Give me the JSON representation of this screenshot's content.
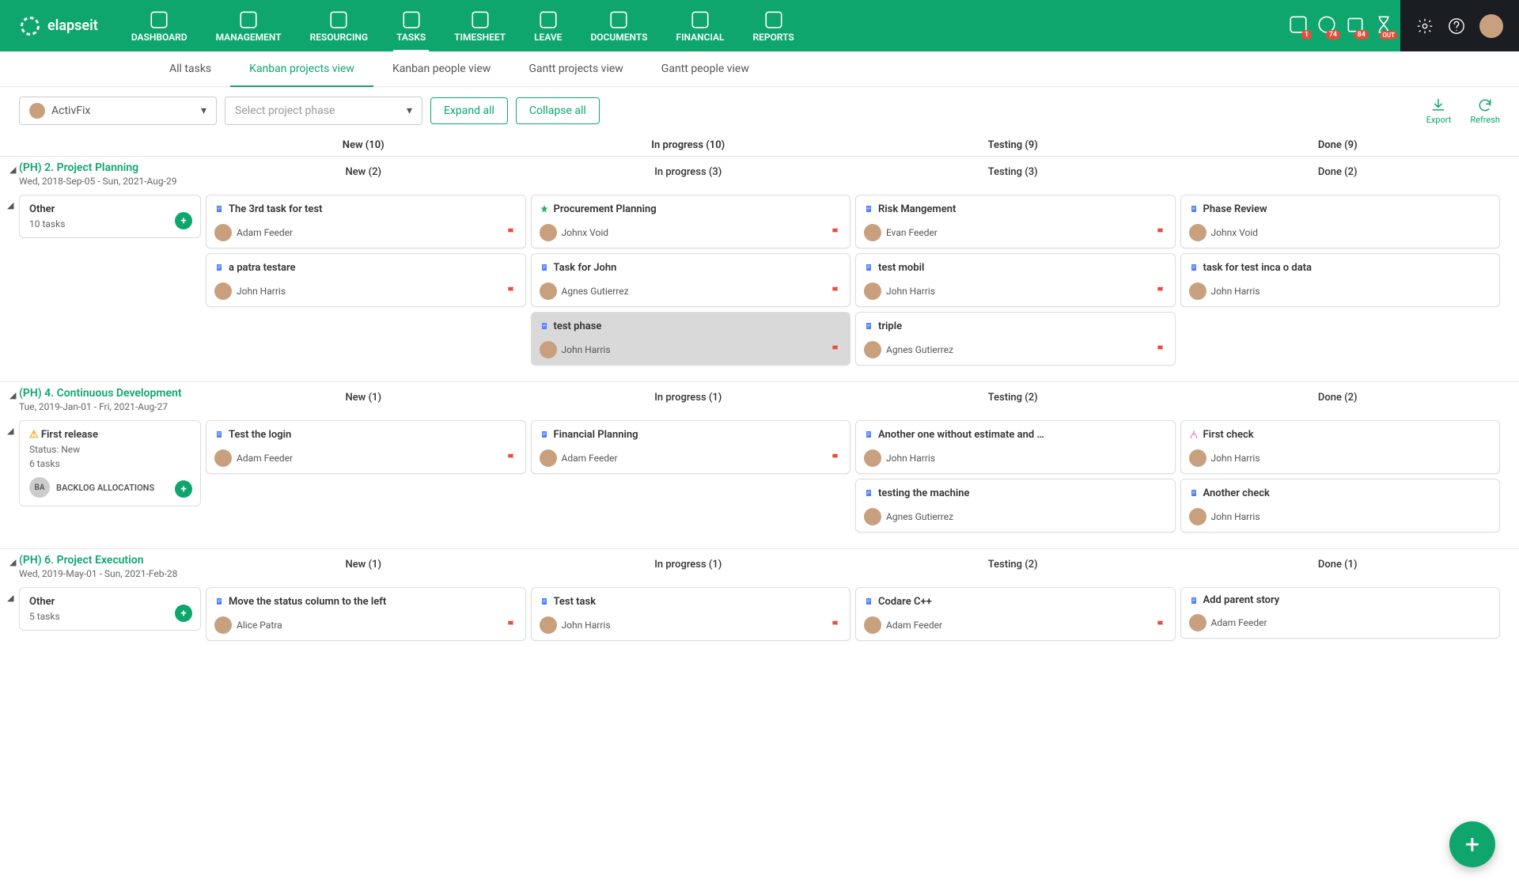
{
  "brand": "elapseit",
  "nav": [
    {
      "label": "DASHBOARD"
    },
    {
      "label": "MANAGEMENT"
    },
    {
      "label": "RESOURCING"
    },
    {
      "label": "TASKS",
      "active": true
    },
    {
      "label": "TIMESHEET"
    },
    {
      "label": "LEAVE"
    },
    {
      "label": "DOCUMENTS"
    },
    {
      "label": "FINANCIAL"
    },
    {
      "label": "REPORTS"
    }
  ],
  "subnav": [
    {
      "label": "All tasks"
    },
    {
      "label": "Kanban projects view",
      "active": true
    },
    {
      "label": "Kanban people view"
    },
    {
      "label": "Gantt projects view"
    },
    {
      "label": "Gantt people view"
    }
  ],
  "badges": {
    "a": "1",
    "b": "74",
    "c": "84",
    "d": "OUT"
  },
  "toolbar": {
    "project": "ActivFix",
    "phase_placeholder": "Select project phase",
    "expand": "Expand all",
    "collapse": "Collapse all",
    "export": "Export",
    "refresh": "Refresh"
  },
  "columns": [
    "New (10)",
    "In progress (10)",
    "Testing (9)",
    "Done (9)"
  ],
  "phases": [
    {
      "title": "(PH) 2. Project Planning",
      "dates": "Wed, 2018-Sep-05 - Sun, 2021-Aug-29",
      "counts": [
        "New (2)",
        "In progress (3)",
        "Testing (3)",
        "Done (2)"
      ],
      "side": {
        "title": "Other",
        "sub": "10 tasks"
      },
      "cols": [
        [
          {
            "t": "The 3rd task for test",
            "a": "Adam Feeder",
            "type": "blue",
            "pri": "down-red",
            "flag": true
          },
          {
            "t": "a patra testare",
            "a": "John Harris",
            "type": "blue",
            "pri": "down-red",
            "flag": true
          }
        ],
        [
          {
            "t": "Procurement Planning",
            "a": "Johnx Void",
            "type": "star",
            "pri": "up-red",
            "flag": true
          },
          {
            "t": "Task for John",
            "a": "Agnes Gutierrez",
            "type": "blue",
            "pri": "down-red",
            "flag": true
          },
          {
            "t": "test phase",
            "a": "John Harris",
            "type": "blue",
            "pri": "down-red",
            "flag": true,
            "dim": true
          }
        ],
        [
          {
            "t": "Risk Mangement",
            "a": "Evan Feeder",
            "type": "blue",
            "pri": "down-red",
            "flag": true
          },
          {
            "t": "test mobil",
            "a": "John Harris",
            "type": "blue",
            "pri": "down-red",
            "flag": true
          },
          {
            "t": "triple",
            "a": "Agnes Gutierrez",
            "type": "blue",
            "pri": "down-red",
            "flag": true
          }
        ],
        [
          {
            "t": "Phase Review",
            "a": "Johnx Void",
            "type": "blue",
            "pri": "down-red"
          },
          {
            "t": "task for test inca o data",
            "a": "John Harris",
            "type": "blue",
            "pri": "down-red"
          }
        ]
      ]
    },
    {
      "title": "(PH) 4. Continuous Development",
      "dates": "Tue, 2019-Jan-01 - Fri, 2021-Aug-27",
      "counts": [
        "New (1)",
        "In progress (1)",
        "Testing (2)",
        "Done (2)"
      ],
      "side": {
        "title": "First release",
        "status": "Status: New",
        "sub": "6 tasks",
        "ba": "BACKLOG ALLOCATIONS",
        "warn": true,
        "pri": "down-red"
      },
      "cols": [
        [
          {
            "t": "Test the login",
            "a": "Adam Feeder",
            "type": "blue",
            "pri": "down-red",
            "flag": true
          }
        ],
        [
          {
            "t": "Financial Planning",
            "a": "Adam Feeder",
            "type": "blue",
            "pri": "down-red",
            "flag": true
          }
        ],
        [
          {
            "t": "Another one without estimate and …",
            "a": "John Harris",
            "type": "blue",
            "pri": "down-red"
          },
          {
            "t": "testing the machine",
            "a": "Agnes Gutierrez",
            "type": "blue",
            "pri": "down-red"
          }
        ],
        [
          {
            "t": "First check",
            "a": "John Harris",
            "type": "pink",
            "pri": "up-red"
          },
          {
            "t": "Another check",
            "a": "John Harris",
            "type": "blue",
            "pri": "down-green"
          }
        ]
      ]
    },
    {
      "title": "(PH) 6. Project Execution",
      "dates": "Wed, 2019-May-01 - Sun, 2021-Feb-28",
      "counts": [
        "New (1)",
        "In progress (1)",
        "Testing (2)",
        "Done (1)"
      ],
      "side": {
        "title": "Other",
        "sub": "5 tasks"
      },
      "cols": [
        [
          {
            "t": "Move the status column to the left",
            "a": "Alice Patra",
            "type": "blue",
            "pri": "down-red",
            "flag": true
          }
        ],
        [
          {
            "t": "Test task",
            "a": "John Harris",
            "type": "blue",
            "pri": "down-red",
            "flag": true
          }
        ],
        [
          {
            "t": "Codare C++",
            "a": "Adam Feeder",
            "type": "blue",
            "pri": "up-red",
            "flag": true
          }
        ],
        [
          {
            "t": "Add parent story",
            "a": "Adam Feeder",
            "type": "blue"
          }
        ]
      ]
    }
  ]
}
